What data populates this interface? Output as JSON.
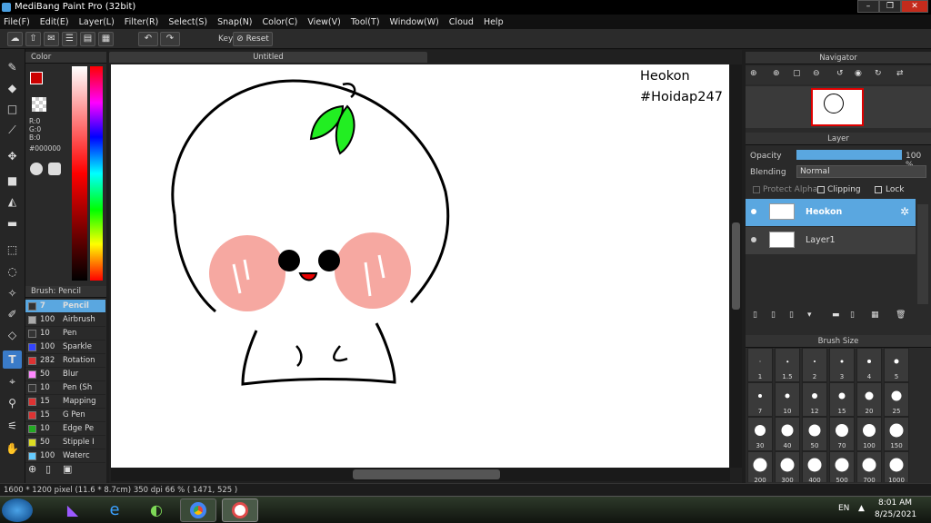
{
  "window": {
    "title": "MediBang Paint Pro (32bit)",
    "controls": [
      "–",
      "❐",
      "✕"
    ]
  },
  "menu": [
    "File(F)",
    "Edit(E)",
    "Layer(L)",
    "Filter(R)",
    "Select(S)",
    "Snap(N)",
    "Color(C)",
    "View(V)",
    "Tool(T)",
    "Window(W)",
    "Cloud",
    "Help"
  ],
  "toolbar": {
    "key_label": "Key",
    "reset_label": "Reset"
  },
  "document": {
    "tab_title": "Untitled",
    "text_line1": "Heokon",
    "text_line2": "#Hoidap247"
  },
  "color_panel": {
    "title": "Color",
    "primary_color": "#cc0000",
    "r_label": "R:0",
    "g_label": "G:0",
    "b_label": "B:0",
    "hex_value": "#000000"
  },
  "brush_panel": {
    "title": "Brush: Pencil",
    "items": [
      {
        "size": "7",
        "name": "Pencil",
        "color": "#333333",
        "selected": true
      },
      {
        "size": "100",
        "name": "Airbrush",
        "color": "#aaaaaa",
        "selected": false
      },
      {
        "size": "10",
        "name": "Pen",
        "color": "#333333",
        "selected": false
      },
      {
        "size": "100",
        "name": "Sparkle",
        "color": "#3344ff",
        "selected": false
      },
      {
        "size": "282",
        "name": "Rotation",
        "color": "#dd3333",
        "selected": false
      },
      {
        "size": "50",
        "name": "Blur",
        "color": "#ff88ff",
        "selected": false
      },
      {
        "size": "10",
        "name": "Pen (Sh",
        "color": "#333333",
        "selected": false
      },
      {
        "size": "15",
        "name": "Mapping",
        "color": "#dd3333",
        "selected": false
      },
      {
        "size": "15",
        "name": "G Pen",
        "color": "#dd3333",
        "selected": false
      },
      {
        "size": "10",
        "name": "Edge Pe",
        "color": "#22aa22",
        "selected": false
      },
      {
        "size": "50",
        "name": "Stipple I",
        "color": "#dddd22",
        "selected": false
      },
      {
        "size": "100",
        "name": "Waterc",
        "color": "#66ccff",
        "selected": false
      }
    ]
  },
  "navigator": {
    "title": "Navigator"
  },
  "layer_panel": {
    "title": "Layer",
    "opacity_label": "Opacity",
    "opacity_value": "100 %",
    "opacity_fraction": 1.0,
    "blending_label": "Blending",
    "blending_value": "Normal",
    "protect_alpha": "Protect Alpha",
    "clipping": "Clipping",
    "lock": "Lock",
    "layers": [
      {
        "name": "Heokon",
        "selected": true
      },
      {
        "name": "Layer1",
        "selected": false
      }
    ]
  },
  "brush_size_panel": {
    "title": "Brush Size",
    "sizes": [
      "1",
      "1.5",
      "2",
      "3",
      "4",
      "5",
      "7",
      "10",
      "12",
      "15",
      "20",
      "25",
      "30",
      "40",
      "50",
      "70",
      "100",
      "150",
      "200",
      "300",
      "400",
      "500",
      "700",
      "1000"
    ]
  },
  "status": {
    "text": "1600 * 1200 pixel   (11.6 * 8.7cm)   350 dpi   66 %   ( 1471, 525 )"
  },
  "taskbar": {
    "lang": "EN",
    "time": "8:01 AM",
    "date": "8/25/2021"
  }
}
